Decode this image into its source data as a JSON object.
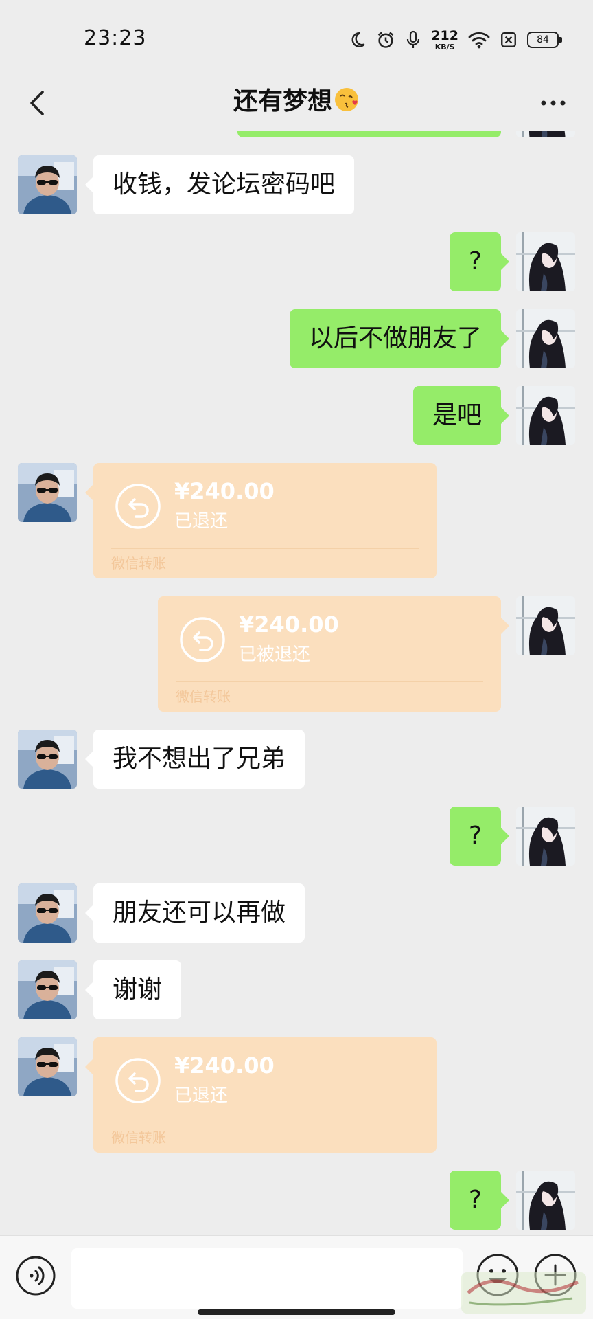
{
  "status_bar": {
    "time": "23:23",
    "net_speed_value": "212",
    "net_speed_unit": "KB/S",
    "battery_level": "84",
    "icons": [
      "moon-icon",
      "alarm-icon",
      "mic-icon",
      "wifi-icon",
      "sim-off-icon",
      "battery-icon"
    ]
  },
  "header": {
    "title": "还有梦想",
    "title_emoji": "kissing-face-emoji",
    "back_icon": "chevron-left-icon",
    "more_icon": "more-dots-icon"
  },
  "messages": [
    {
      "side": "right",
      "type": "text",
      "text": "",
      "partial": true
    },
    {
      "side": "left",
      "type": "text",
      "text": "收钱，发论坛密码吧"
    },
    {
      "side": "right",
      "type": "text",
      "text": "?"
    },
    {
      "side": "right",
      "type": "text",
      "text": "以后不做朋友了"
    },
    {
      "side": "right",
      "type": "text",
      "text": "是吧"
    },
    {
      "side": "left",
      "type": "transfer",
      "amount": "¥240.00",
      "status": "已退还",
      "label": "微信转账"
    },
    {
      "side": "right",
      "type": "transfer",
      "amount": "¥240.00",
      "status": "已被退还",
      "label": "微信转账"
    },
    {
      "side": "left",
      "type": "text",
      "text": "我不想出了兄弟"
    },
    {
      "side": "right",
      "type": "text",
      "text": "?"
    },
    {
      "side": "left",
      "type": "text",
      "text": "朋友还可以再做"
    },
    {
      "side": "left",
      "type": "text",
      "text": "谢谢"
    },
    {
      "side": "left",
      "type": "transfer",
      "amount": "¥240.00",
      "status": "已退还",
      "label": "微信转账"
    },
    {
      "side": "right",
      "type": "text",
      "text": "?"
    }
  ],
  "input_bar": {
    "text_value": "",
    "icons": [
      "voice-icon",
      "emoji-icon",
      "plus-icon"
    ]
  },
  "colors": {
    "background": "#ededed",
    "bubble_self": "#95ec69",
    "bubble_other": "#ffffff",
    "transfer_card": "#fbdfbe"
  }
}
